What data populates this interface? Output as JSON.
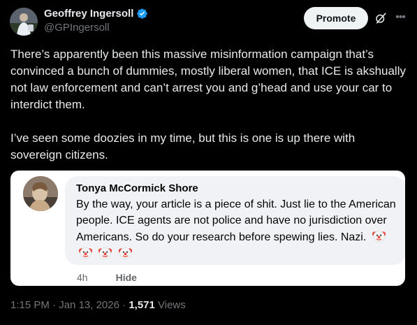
{
  "author": {
    "name": "Geoffrey Ingersoll",
    "handle": "@GPIngersoll",
    "verified_color": "#1d9bf0"
  },
  "header_actions": {
    "promote_label": "Promote",
    "grok_icon": "grok-icon",
    "more_icon": "more-icon"
  },
  "tweet": {
    "paragraphs": [
      "There’s apparently been this massive misinformation campaign that’s convinced a bunch of dummies, mostly liberal women, that ICE is akshually not law enforcement and can’t arrest you and g’head and use your car to interdict them.",
      "I’ve seen some doozies in my time, but this is one is up there with sovereign citizens."
    ]
  },
  "embedded_comment": {
    "commenter_name": "Tonya McCormick Shore",
    "text": "By the way, your article is a piece of shit. Just lie to the American people. ICE agents are not police and have no jurisdiction over Americans. So do your research before spewing lies. Nazi.",
    "emoji_icon": "clown-face-icon",
    "emoji_count": 4,
    "time": "4h",
    "hide_label": "Hide"
  },
  "meta": {
    "time": "1:15 PM",
    "separator1": " · ",
    "date": "Jan 13, 2026",
    "separator2": " · ",
    "views_count": "1,571",
    "views_label": " Views"
  },
  "colors": {
    "background": "#000000",
    "text_primary": "#e7e9ea",
    "text_secondary": "#71767b",
    "verified": "#1d9bf0",
    "promote_bg": "#eff3f4",
    "card_bg": "#ffffff",
    "bubble_bg": "#f0f2f5"
  }
}
